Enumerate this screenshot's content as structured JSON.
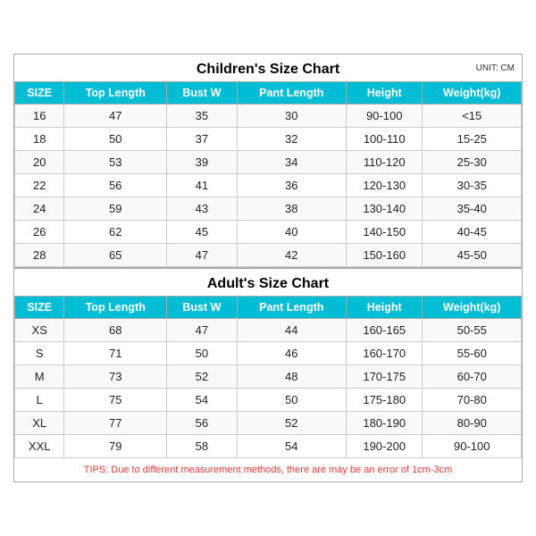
{
  "children_title": "Children's Size Chart",
  "adult_title": "Adult's Size Chart",
  "unit": "UNIT: CM",
  "tips": "TIPS: Due to different measurement methods, there are may be an error of 1cm-3cm",
  "headers": [
    "SIZE",
    "Top Length",
    "Bust W",
    "Pant Length",
    "Height",
    "Weight(kg)"
  ],
  "children_rows": [
    [
      "16",
      "47",
      "35",
      "30",
      "90-100",
      "<15"
    ],
    [
      "18",
      "50",
      "37",
      "32",
      "100-110",
      "15-25"
    ],
    [
      "20",
      "53",
      "39",
      "34",
      "110-120",
      "25-30"
    ],
    [
      "22",
      "56",
      "41",
      "36",
      "120-130",
      "30-35"
    ],
    [
      "24",
      "59",
      "43",
      "38",
      "130-140",
      "35-40"
    ],
    [
      "26",
      "62",
      "45",
      "40",
      "140-150",
      "40-45"
    ],
    [
      "28",
      "65",
      "47",
      "42",
      "150-160",
      "45-50"
    ]
  ],
  "adult_rows": [
    [
      "XS",
      "68",
      "47",
      "44",
      "160-165",
      "50-55"
    ],
    [
      "S",
      "71",
      "50",
      "46",
      "160-170",
      "55-60"
    ],
    [
      "M",
      "73",
      "52",
      "48",
      "170-175",
      "60-70"
    ],
    [
      "L",
      "75",
      "54",
      "50",
      "175-180",
      "70-80"
    ],
    [
      "XL",
      "77",
      "56",
      "52",
      "180-190",
      "80-90"
    ],
    [
      "XXL",
      "79",
      "58",
      "54",
      "190-200",
      "90-100"
    ]
  ]
}
